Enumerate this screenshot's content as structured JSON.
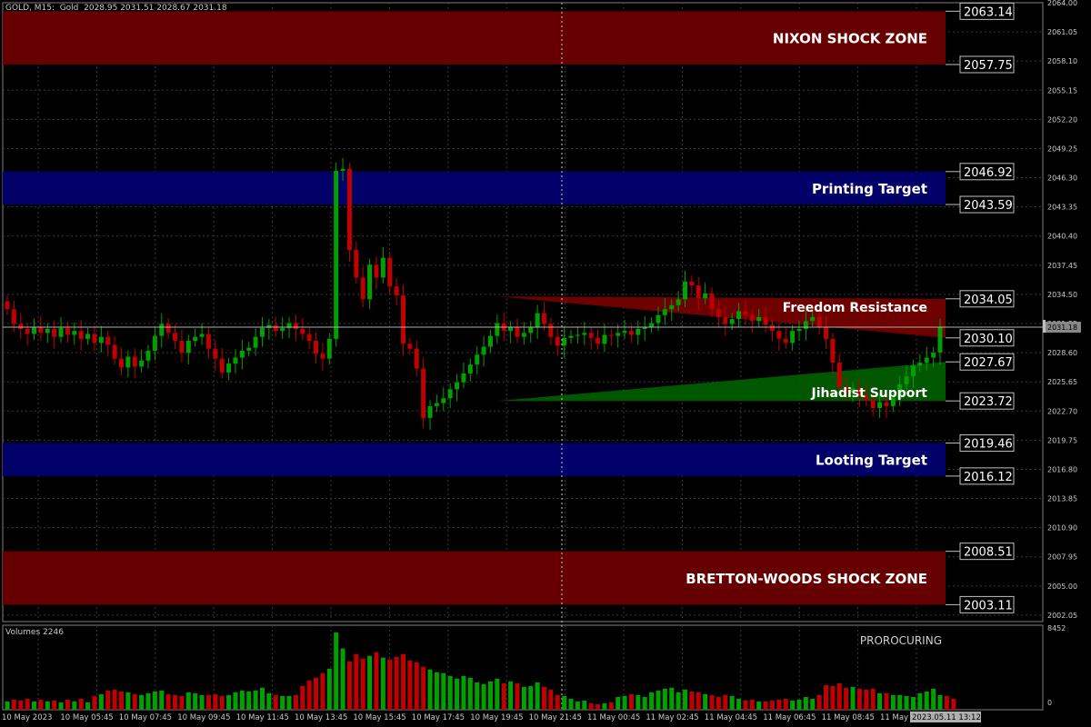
{
  "header": {
    "symbol_info": "GOLD, M15:  Gold  2028.95 2031.51 2028.67 2031.18"
  },
  "volume_panel": {
    "label": "Volumes 2246",
    "signature": "PROROCURING",
    "scale_max": "8452",
    "scale_min": "0"
  },
  "colors": {
    "background": "#000000",
    "grid": "#3a3a3a",
    "bull": "#00a000",
    "bear": "#c00000",
    "shock_zone": "#6b0000",
    "target_zone": "#00006e",
    "resistance": "#7a0000",
    "support": "#006000",
    "text": "#ffffff",
    "axis_text": "#c8c8c8"
  },
  "chart_data": {
    "type": "candlestick",
    "symbol": "GOLD",
    "timeframe": "M15",
    "ylim": [
      2001.4,
      2064.0
    ],
    "y_ticks": [
      2064.0,
      2061.05,
      2058.1,
      2055.15,
      2052.2,
      2049.25,
      2046.3,
      2043.35,
      2040.4,
      2037.45,
      2034.5,
      2031.55,
      2028.6,
      2025.65,
      2022.7,
      2019.75,
      2016.8,
      2013.85,
      2010.9,
      2007.95,
      2005.0,
      2002.05
    ],
    "x_tick_labels": [
      "10 May 2023",
      "10 May 05:45",
      "10 May 07:45",
      "10 May 09:45",
      "10 May 11:45",
      "10 May 13:45",
      "10 May 15:45",
      "10 May 17:45",
      "10 May 19:45",
      "10 May 21:45",
      "11 May 00:45",
      "11 May 02:45",
      "11 May 04:45",
      "11 May 06:45",
      "11 May 08:45",
      "11 May 1"
    ],
    "current_time_label": "2023.05.11 13:12",
    "current_price": "2031.18",
    "zones": [
      {
        "label": "NIXON SHOCK ZONE",
        "top": 2063.14,
        "bottom": 2057.75,
        "kind": "shock"
      },
      {
        "label": "Printing Target",
        "top": 2046.92,
        "bottom": 2043.59,
        "kind": "target"
      },
      {
        "label": "Looting Target",
        "top": 2019.46,
        "bottom": 2016.12,
        "kind": "target"
      },
      {
        "label": "BRETTON-WOODS SHOCK ZONE",
        "top": 2008.51,
        "bottom": 2003.11,
        "kind": "shock"
      }
    ],
    "triangles": [
      {
        "label": "Freedom Resistance",
        "apex": 2034.3,
        "top": 2034.05,
        "bottom": 2030.1,
        "kind": "resistance"
      },
      {
        "label": "Jihadist Support",
        "apex": 2023.72,
        "top": 2027.67,
        "bottom": 2023.72,
        "kind": "support"
      }
    ],
    "price_labels": [
      "2063.14",
      "2057.75",
      "2046.92",
      "2043.59",
      "2034.05",
      "2030.10",
      "2027.67",
      "2023.72",
      "2019.46",
      "2016.12",
      "2008.51",
      "2003.11"
    ],
    "closes": [
      2033.0,
      2031.5,
      2031.0,
      2030.5,
      2031.2,
      2030.6,
      2031.0,
      2030.2,
      2031.1,
      2030.4,
      2030.8,
      2030.0,
      2030.5,
      2029.6,
      2030.2,
      2029.4,
      2028.0,
      2027.1,
      2028.2,
      2027.2,
      2027.8,
      2028.8,
      2030.3,
      2031.5,
      2030.6,
      2029.8,
      2028.6,
      2029.8,
      2030.2,
      2030.5,
      2029.0,
      2028.0,
      2026.6,
      2027.5,
      2028.1,
      2028.8,
      2029.1,
      2030.2,
      2031.1,
      2031.4,
      2030.8,
      2031.1,
      2031.6,
      2031.0,
      2030.5,
      2029.8,
      2028.5,
      2028.0,
      2030.0,
      2047.0,
      2047.2,
      2039.0,
      2036.2,
      2034.0,
      2037.5,
      2036.2,
      2038.2,
      2035.3,
      2034.4,
      2029.5,
      2029.0,
      2027.0,
      2022.0,
      2023.2,
      2023.5,
      2024.0,
      2024.9,
      2025.6,
      2026.5,
      2027.4,
      2028.4,
      2029.2,
      2030.3,
      2031.6,
      2030.8,
      2031.2,
      2030.2,
      2030.6,
      2031.2,
      2032.6,
      2031.5,
      2030.2,
      2029.3,
      2030.1,
      2030.3,
      2030.4,
      2030.6,
      2030.1,
      2029.5,
      2030.4,
      2030.3,
      2030.6,
      2030.8,
      2030.4,
      2031.0,
      2031.2,
      2031.6,
      2032.4,
      2033.0,
      2033.4,
      2034.0,
      2035.8,
      2035.4,
      2034.1,
      2034.6,
      2033.0,
      2032.2,
      2031.5,
      2032.0,
      2032.8,
      2032.4,
      2031.8,
      2032.2,
      2031.4,
      2030.8,
      2030.0,
      2029.6,
      2030.8,
      2031.0,
      2031.8,
      2032.2,
      2031.2,
      2030.0,
      2027.6,
      2025.1,
      2024.6,
      2025.0,
      2024.3,
      2023.8,
      2023.0,
      2023.6,
      2023.2,
      2024.0,
      2025.4,
      2026.2,
      2027.3,
      2027.6,
      2028.1,
      2028.6,
      2031.2
    ],
    "volumes": [
      900,
      1100,
      1000,
      1200,
      900,
      1100,
      900,
      1000,
      800,
      1100,
      900,
      1200,
      800,
      1500,
      1700,
      2100,
      2200,
      2000,
      1900,
      1700,
      1600,
      1800,
      2000,
      2100,
      1700,
      1600,
      1500,
      1900,
      1800,
      1600,
      1600,
      1700,
      1500,
      1600,
      1900,
      2100,
      2000,
      2100,
      2400,
      1800,
      1600,
      1500,
      1500,
      1600,
      2600,
      3200,
      3500,
      4000,
      4500,
      8452,
      6700,
      5300,
      6100,
      5600,
      5900,
      6300,
      5700,
      5500,
      5800,
      6100,
      5400,
      5200,
      4700,
      4400,
      4100,
      4000,
      3700,
      3400,
      3700,
      3500,
      3000,
      2800,
      3100,
      3400,
      2900,
      3100,
      2900,
      2500,
      2600,
      3000,
      2500,
      2200,
      1600,
      1500,
      1200,
      900,
      1000,
      700,
      600,
      700,
      800,
      1400,
      1500,
      1700,
      1600,
      1400,
      1900,
      2100,
      2300,
      2400,
      1900,
      2200,
      2000,
      1900,
      1700,
      1600,
      1400,
      1600,
      1500,
      1200,
      1000,
      1100,
      900,
      900,
      1000,
      1100,
      1200,
      1000,
      1100,
      1400,
      1200,
      1600,
      2700,
      2600,
      2900,
      2400,
      2500,
      2300,
      2200,
      2300,
      1800,
      1800,
      1600,
      1600,
      1500,
      1400,
      1800,
      2000,
      2300,
      1600,
      1500,
      1200
    ]
  }
}
